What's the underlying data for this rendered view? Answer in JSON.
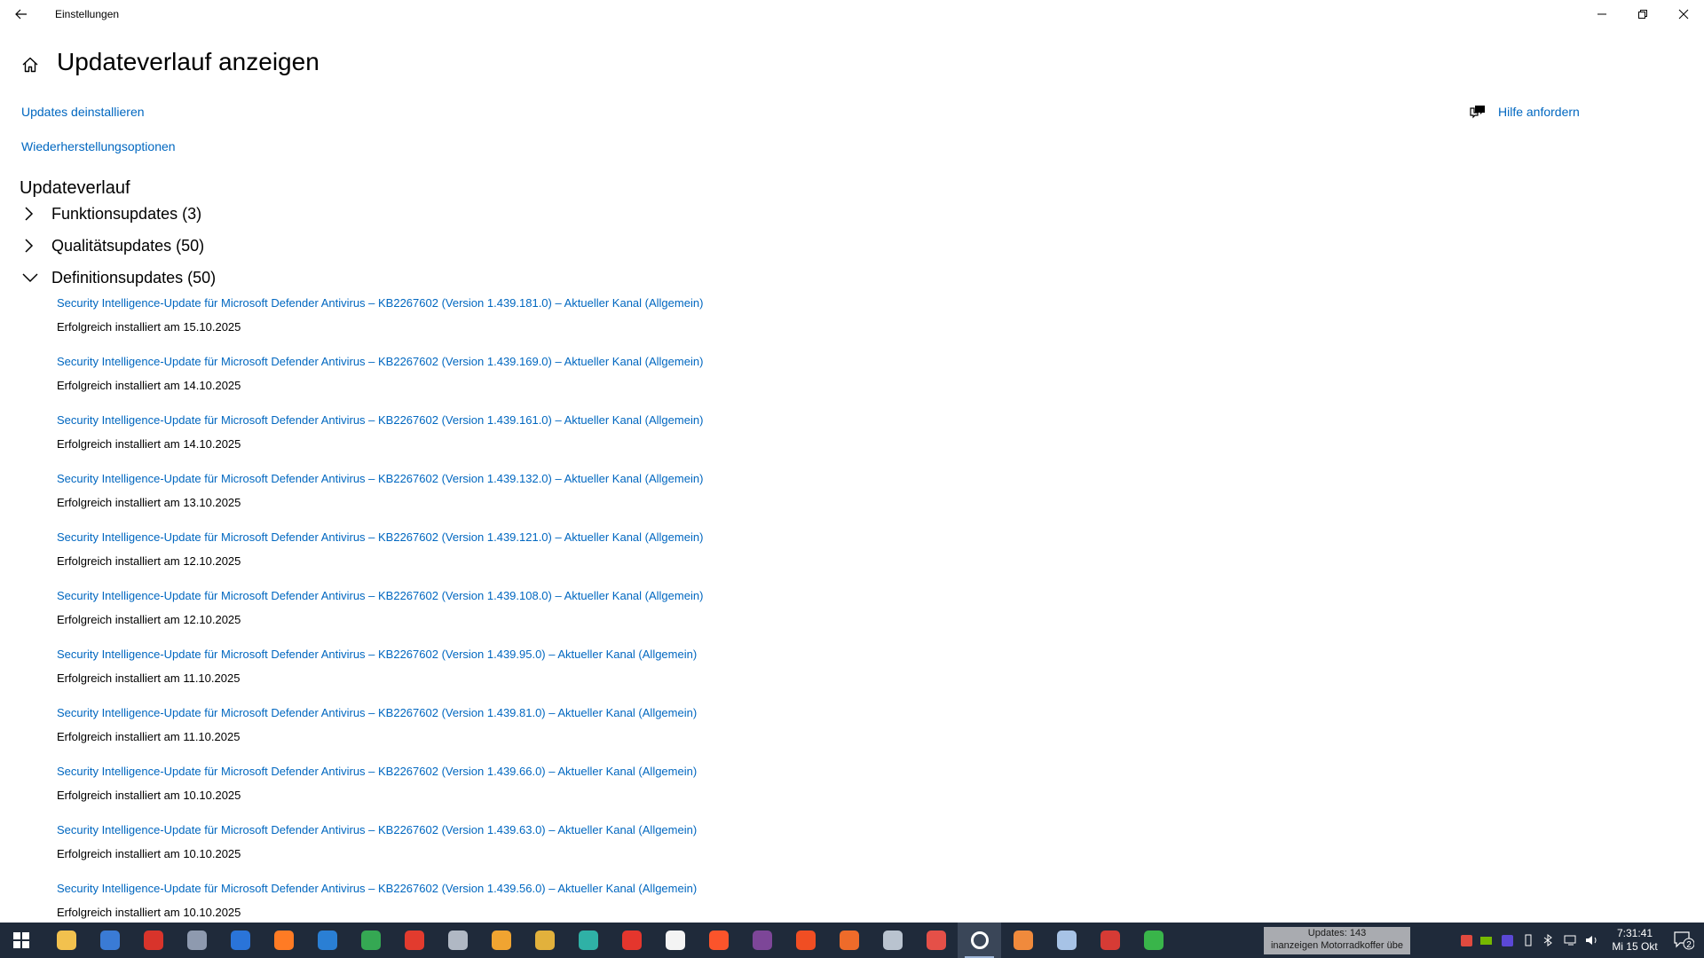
{
  "window": {
    "title": "Einstellungen",
    "back_icon": "back-arrow-icon",
    "minimize_icon": "minimize-icon",
    "maximize_icon": "restore-icon",
    "close_icon": "close-icon"
  },
  "page": {
    "title": "Updateverlauf anzeigen",
    "home_icon": "home-icon",
    "links": {
      "uninstall": "Updates deinstallieren",
      "recovery": "Wiederherstellungsoptionen",
      "help": "Hilfe anfordern"
    },
    "section_title": "Updateverlauf",
    "groups": [
      {
        "label": "Funktionsupdates (3)",
        "expanded": false
      },
      {
        "label": "Qualitätsupdates (50)",
        "expanded": false
      },
      {
        "label": "Definitionsupdates (50)",
        "expanded": true
      }
    ],
    "updates": [
      {
        "title": "Security Intelligence-Update für Microsoft Defender Antivirus – KB2267602 (Version 1.439.181.0) – Aktueller Kanal (Allgemein)",
        "status": "Erfolgreich installiert am 15.10.2025"
      },
      {
        "title": "Security Intelligence-Update für Microsoft Defender Antivirus – KB2267602 (Version 1.439.169.0) – Aktueller Kanal (Allgemein)",
        "status": "Erfolgreich installiert am 14.10.2025"
      },
      {
        "title": "Security Intelligence-Update für Microsoft Defender Antivirus – KB2267602 (Version 1.439.161.0) – Aktueller Kanal (Allgemein)",
        "status": "Erfolgreich installiert am 14.10.2025"
      },
      {
        "title": "Security Intelligence-Update für Microsoft Defender Antivirus – KB2267602 (Version 1.439.132.0) – Aktueller Kanal (Allgemein)",
        "status": "Erfolgreich installiert am 13.10.2025"
      },
      {
        "title": "Security Intelligence-Update für Microsoft Defender Antivirus – KB2267602 (Version 1.439.121.0) – Aktueller Kanal (Allgemein)",
        "status": "Erfolgreich installiert am 12.10.2025"
      },
      {
        "title": "Security Intelligence-Update für Microsoft Defender Antivirus – KB2267602 (Version 1.439.108.0) – Aktueller Kanal (Allgemein)",
        "status": "Erfolgreich installiert am 12.10.2025"
      },
      {
        "title": "Security Intelligence-Update für Microsoft Defender Antivirus – KB2267602 (Version 1.439.95.0) – Aktueller Kanal (Allgemein)",
        "status": "Erfolgreich installiert am 11.10.2025"
      },
      {
        "title": "Security Intelligence-Update für Microsoft Defender Antivirus – KB2267602 (Version 1.439.81.0) – Aktueller Kanal (Allgemein)",
        "status": "Erfolgreich installiert am 11.10.2025"
      },
      {
        "title": "Security Intelligence-Update für Microsoft Defender Antivirus – KB2267602 (Version 1.439.66.0) – Aktueller Kanal (Allgemein)",
        "status": "Erfolgreich installiert am 10.10.2025"
      },
      {
        "title": "Security Intelligence-Update für Microsoft Defender Antivirus – KB2267602 (Version 1.439.63.0) – Aktueller Kanal (Allgemein)",
        "status": "Erfolgreich installiert am 10.10.2025"
      },
      {
        "title": "Security Intelligence-Update für Microsoft Defender Antivirus – KB2267602 (Version 1.439.56.0) – Aktueller Kanal (Allgemein)",
        "status": "Erfolgreich installiert am 10.10.2025"
      }
    ]
  },
  "colors": {
    "link": "#0067c0",
    "taskbar": "#1f2a3a",
    "notification_bg": "#a9abb0"
  },
  "taskbar": {
    "apps": [
      {
        "name": "file-explorer",
        "color": "#f2c14e"
      },
      {
        "name": "window-app",
        "color": "#3a7bd5"
      },
      {
        "name": "red-app",
        "color": "#d8342b"
      },
      {
        "name": "eye-app",
        "color": "#8e9aaf"
      },
      {
        "name": "thunderbird",
        "color": "#2a74d9"
      },
      {
        "name": "firefox",
        "color": "#ff7b24"
      },
      {
        "name": "writer",
        "color": "#2a7fd4"
      },
      {
        "name": "calc",
        "color": "#35a853"
      },
      {
        "name": "tool-app",
        "color": "#e23b2e"
      },
      {
        "name": "rocket-app",
        "color": "#b0b8c4"
      },
      {
        "name": "sun-app",
        "color": "#f0a431"
      },
      {
        "name": "browser-app",
        "color": "#e2b13c"
      },
      {
        "name": "edge",
        "color": "#2fb1a6"
      },
      {
        "name": "red-circle-app",
        "color": "#e4362d"
      },
      {
        "name": "vivaldi",
        "color": "#f4f4f4"
      },
      {
        "name": "brave",
        "color": "#fb542b"
      },
      {
        "name": "tor-app",
        "color": "#7d4698"
      },
      {
        "name": "grid-app",
        "color": "#f04e23"
      },
      {
        "name": "orange-app",
        "color": "#ee6b2a"
      },
      {
        "name": "network-app",
        "color": "#b9c3cf"
      },
      {
        "name": "close-app",
        "color": "#e55048"
      },
      {
        "name": "settings",
        "color": "#ffffff",
        "active": true
      },
      {
        "name": "orange-square-app",
        "color": "#f08a3c"
      },
      {
        "name": "image-app",
        "color": "#a7c3e6"
      },
      {
        "name": "weather-app",
        "color": "#d63b35"
      },
      {
        "name": "green-u-app",
        "color": "#39b54a"
      }
    ],
    "notification_lines": [
      "Updates: 143",
      "inanzeigen Motorradkoffer übe"
    ],
    "clock_time": "7:31:41",
    "clock_date": "Mi 15 Okt",
    "action_center_badge": "2"
  }
}
